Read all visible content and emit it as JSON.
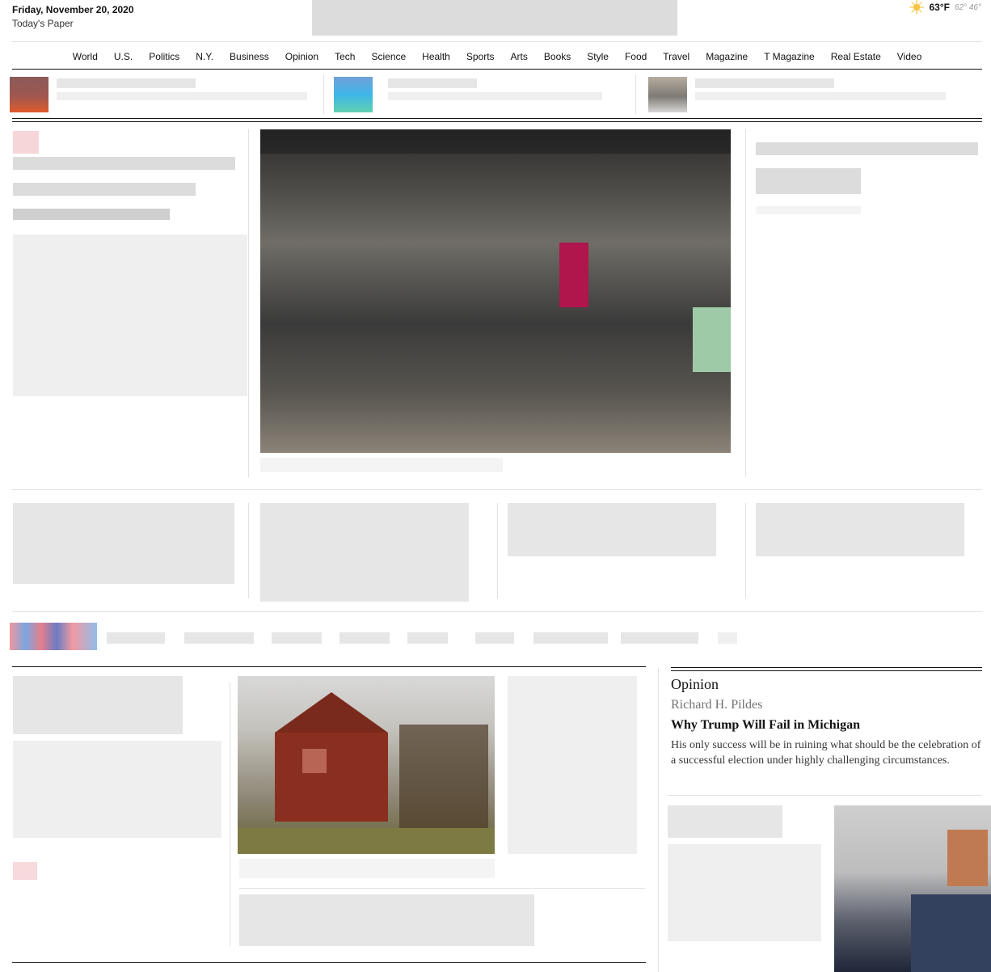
{
  "masthead": {
    "date": "Friday, November 20, 2020",
    "todays_paper": "Today's Paper",
    "weather": {
      "icon": "sun-icon",
      "temp": "63°F",
      "hilo": "62° 46°"
    }
  },
  "nav": {
    "items": [
      "World",
      "U.S.",
      "Politics",
      "N.Y.",
      "Business",
      "Opinion",
      "Tech",
      "Science",
      "Health",
      "Sports",
      "Arts",
      "Books",
      "Style",
      "Food",
      "Travel",
      "Magazine",
      "T Magazine",
      "Real Estate",
      "Video"
    ]
  },
  "opinion": {
    "label": "Opinion",
    "author": "Richard H. Pildes",
    "headline": "Why Trump Will Fail in Michigan",
    "summary": "His only success will be in ruining what should be the celebration of a successful election under highly challenging circumstances."
  },
  "colors": {
    "text": "#121212",
    "rule": "#e2e2e2",
    "muted": "#727272"
  }
}
